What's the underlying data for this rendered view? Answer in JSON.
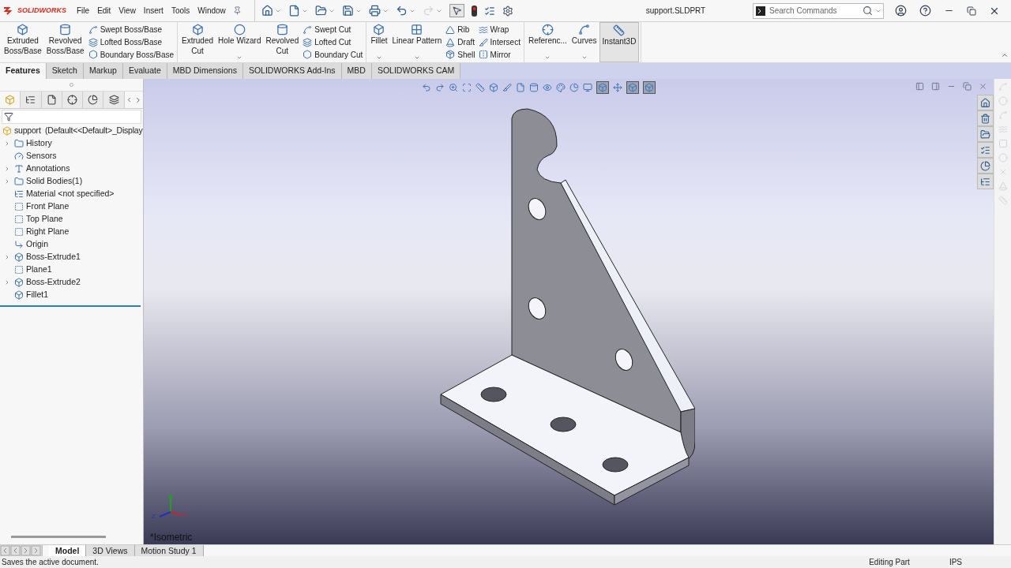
{
  "app": {
    "logo": "SOLIDWORKS",
    "title": "support.SLDPRT"
  },
  "menus": [
    "File",
    "Edit",
    "View",
    "Insert",
    "Tools",
    "Window"
  ],
  "search": {
    "placeholder": "Search Commands"
  },
  "ribbon": [
    {
      "items": [
        {
          "kind": "large",
          "label": "Extruded\nBoss/Base",
          "dropdown": false,
          "selected": false
        },
        {
          "kind": "large",
          "label": "Revolved\nBoss/Base",
          "dropdown": false,
          "selected": false
        },
        {
          "kind": "stack",
          "items": [
            {
              "label": "Swept Boss/Base"
            },
            {
              "label": "Lofted Boss/Base"
            },
            {
              "label": "Boundary Boss/Base"
            }
          ]
        }
      ]
    },
    {
      "items": [
        {
          "kind": "large",
          "label": "Extruded\nCut",
          "dropdown": false,
          "selected": false
        },
        {
          "kind": "large",
          "label": "Hole Wizard",
          "dropdown": true,
          "selected": false
        },
        {
          "kind": "large",
          "label": "Revolved\nCut",
          "dropdown": false,
          "selected": false
        },
        {
          "kind": "stack",
          "items": [
            {
              "label": "Swept Cut"
            },
            {
              "label": "Lofted Cut"
            },
            {
              "label": "Boundary Cut"
            }
          ]
        }
      ]
    },
    {
      "items": [
        {
          "kind": "large",
          "label": "Fillet",
          "dropdown": true,
          "selected": false
        },
        {
          "kind": "large",
          "label": "Linear Pattern",
          "dropdown": true,
          "selected": false
        },
        {
          "kind": "stack",
          "items": [
            {
              "label": "Rib"
            },
            {
              "label": "Draft"
            },
            {
              "label": "Shell"
            }
          ]
        },
        {
          "kind": "stack",
          "items": [
            {
              "label": "Wrap"
            },
            {
              "label": "Intersect"
            },
            {
              "label": "Mirror"
            }
          ]
        }
      ]
    },
    {
      "items": [
        {
          "kind": "large",
          "label": "Referenc...",
          "dropdown": true,
          "selected": false
        },
        {
          "kind": "large",
          "label": "Curves",
          "dropdown": true,
          "selected": false
        },
        {
          "kind": "large",
          "label": "Instant3D",
          "dropdown": false,
          "selected": true
        }
      ]
    }
  ],
  "command_tabs": [
    {
      "label": "Features",
      "selected": true
    },
    {
      "label": "Sketch",
      "selected": false
    },
    {
      "label": "Markup",
      "selected": false
    },
    {
      "label": "Evaluate",
      "selected": false
    },
    {
      "label": "MBD Dimensions",
      "selected": false
    },
    {
      "label": "SOLIDWORKS Add-Ins",
      "selected": false
    },
    {
      "label": "MBD",
      "selected": false
    },
    {
      "label": "SOLIDWORKS CAM",
      "selected": false
    }
  ],
  "panel_tabs": [
    {
      "selected": true
    },
    {
      "selected": false
    },
    {
      "selected": false
    },
    {
      "selected": false
    },
    {
      "selected": false
    },
    {
      "selected": false
    }
  ],
  "feature_tree": {
    "root": "support  (Default<<Default>_Display",
    "items": [
      {
        "label": "History",
        "kind": "history",
        "expandable": true
      },
      {
        "label": "Sensors",
        "kind": "sensors",
        "expandable": false
      },
      {
        "label": "Annotations",
        "kind": "annotations",
        "expandable": true
      },
      {
        "label": "Solid Bodies(1)",
        "kind": "bodies",
        "expandable": true
      },
      {
        "label": "Material <not specified>",
        "kind": "material",
        "expandable": false
      },
      {
        "label": "Front Plane",
        "kind": "plane",
        "expandable": false
      },
      {
        "label": "Top Plane",
        "kind": "plane",
        "expandable": false
      },
      {
        "label": "Right Plane",
        "kind": "plane",
        "expandable": false
      },
      {
        "label": "Origin",
        "kind": "origin",
        "expandable": false
      },
      {
        "label": "Boss-Extrude1",
        "kind": "extrude",
        "expandable": true
      },
      {
        "label": "Plane1",
        "kind": "plane",
        "expandable": false
      },
      {
        "label": "Boss-Extrude2",
        "kind": "extrude",
        "expandable": true
      },
      {
        "label": "Fillet1",
        "kind": "fillet",
        "expandable": false
      }
    ]
  },
  "viewport": {
    "view_name": "*Isometric",
    "triad": {
      "z": "Z",
      "x": "X"
    }
  },
  "bottom_tabs": [
    {
      "label": "Model",
      "selected": true
    },
    {
      "label": "3D Views",
      "selected": false
    },
    {
      "label": "Motion Study 1",
      "selected": false
    }
  ],
  "status": {
    "message": "Saves the active document.",
    "mode": "Editing Part",
    "units": "IPS"
  }
}
